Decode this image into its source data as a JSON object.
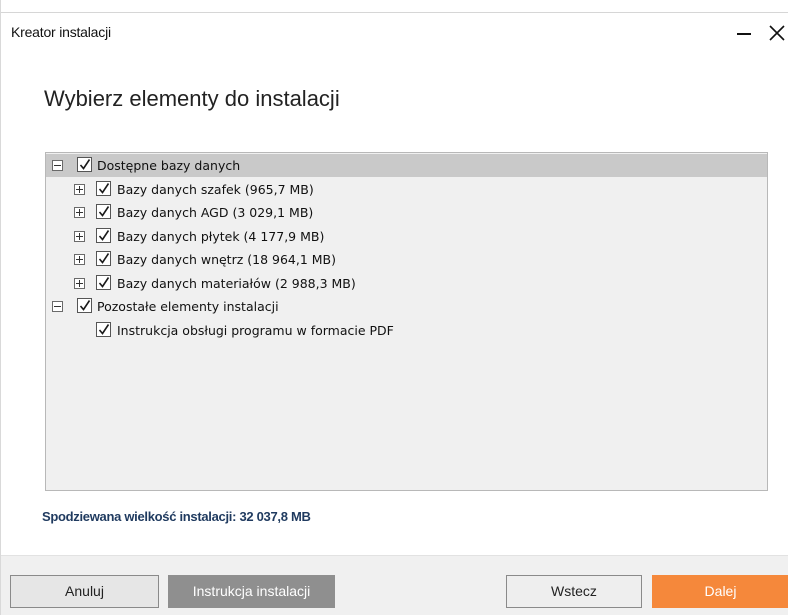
{
  "window": {
    "title": "Kreator instalacji"
  },
  "page": {
    "heading": "Wybierz elementy do instalacji"
  },
  "tree": {
    "items": [
      {
        "label": "Dostępne bazy danych",
        "level": 0,
        "expander": "minus",
        "checked": true,
        "selected": true
      },
      {
        "label": "Bazy danych szafek (965,7 MB)",
        "level": 1,
        "expander": "plus",
        "checked": true,
        "selected": false
      },
      {
        "label": "Bazy danych AGD (3 029,1 MB)",
        "level": 1,
        "expander": "plus",
        "checked": true,
        "selected": false
      },
      {
        "label": "Bazy danych płytek (4 177,9 MB)",
        "level": 1,
        "expander": "plus",
        "checked": true,
        "selected": false
      },
      {
        "label": "Bazy danych wnętrz (18 964,1 MB)",
        "level": 1,
        "expander": "plus",
        "checked": true,
        "selected": false
      },
      {
        "label": "Bazy danych materiałów (2 988,3 MB)",
        "level": 1,
        "expander": "plus",
        "checked": true,
        "selected": false
      },
      {
        "label": "Pozostałe elementy instalacji",
        "level": 0,
        "expander": "minus",
        "checked": true,
        "selected": false
      },
      {
        "label": "Instrukcja obsługi programu w formacie PDF",
        "level": 1,
        "expander": "none",
        "checked": true,
        "selected": false
      }
    ]
  },
  "summary": {
    "expected_size": "Spodziewana wielkość instalacji: 32 037,8 MB"
  },
  "buttons": {
    "cancel": "Anuluj",
    "guide": "Instrukcja instalacji",
    "back": "Wstecz",
    "next": "Dalej"
  },
  "colors": {
    "accent": "#f5883b",
    "disabled_button": "#8f8f8f",
    "summary_text": "#1f3a5f",
    "selection": "#c9c9c9"
  },
  "icons": {
    "minimize": "minimize-icon",
    "close": "close-icon",
    "checkbox": "checkmark-icon",
    "expand": "plus-expander-icon",
    "collapse": "minus-expander-icon"
  }
}
